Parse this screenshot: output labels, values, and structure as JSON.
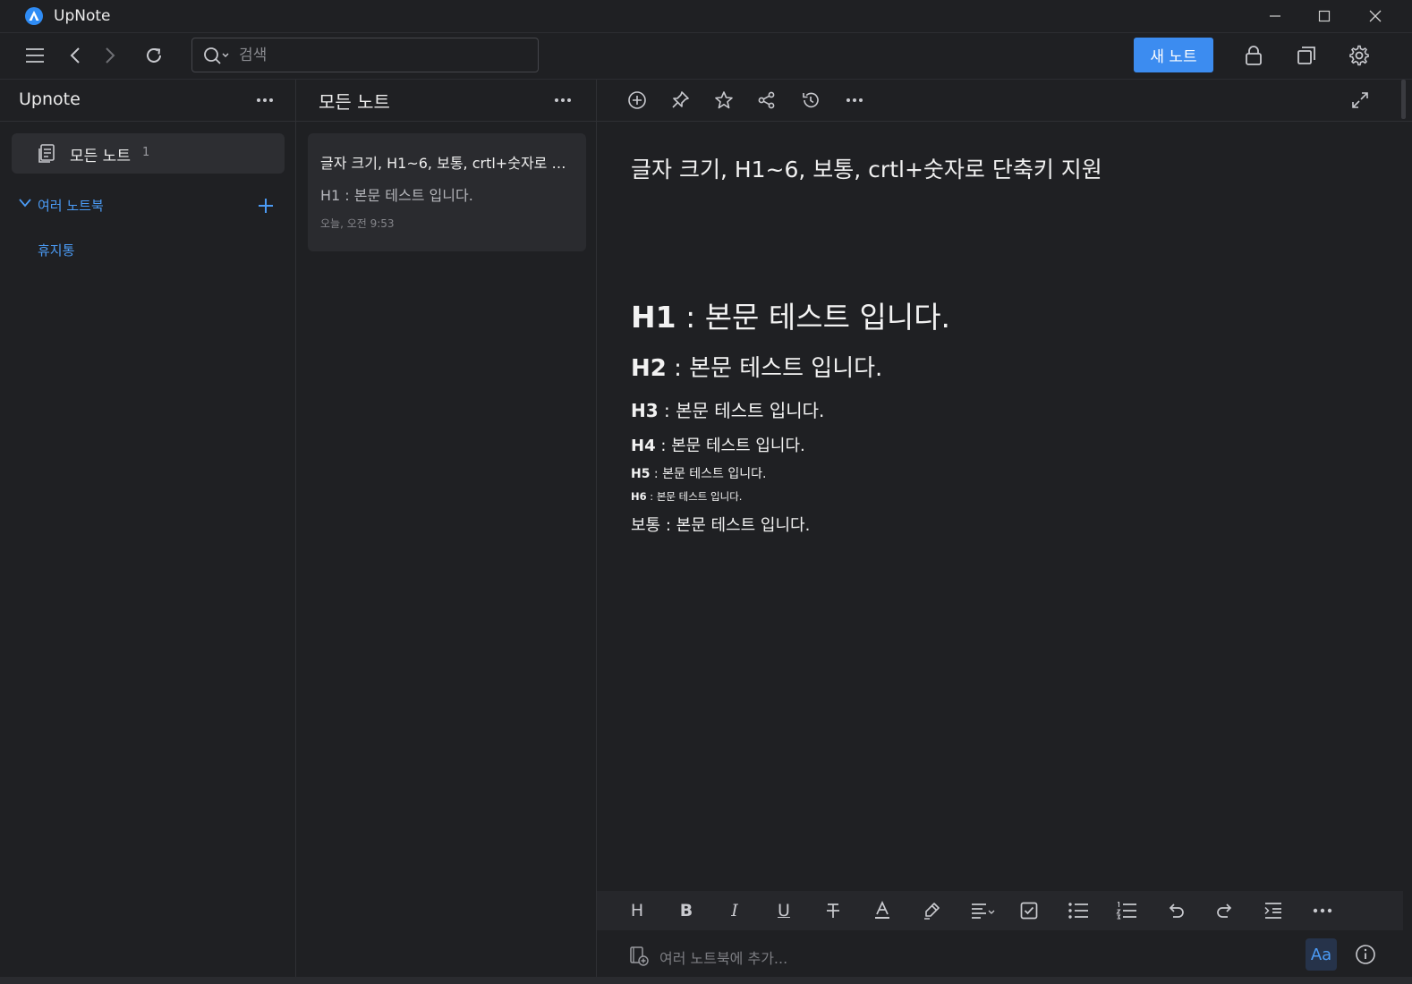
{
  "window": {
    "title": "UpNote",
    "logo_icon": "upnote-logo-icon",
    "controls": [
      "minimize-icon",
      "maximize-icon",
      "close-icon"
    ]
  },
  "toolbar": {
    "search_placeholder": "검색",
    "new_note_label": "새 노트",
    "accent": "#3c8cf0"
  },
  "sidebar": {
    "title": "Upnote",
    "all_notes_label": "모든 노트",
    "all_notes_count": "1",
    "notebooks_label": "여러 노트북",
    "trash_label": "휴지통",
    "link_color": "#4b9bf5"
  },
  "notelist": {
    "title": "모든 노트",
    "notes": [
      {
        "title": "글자 크기, H1~6, 보통, crtl+숫자로 단축키 지원",
        "preview": "H1 : 본문 테스트 입니다.",
        "date": "오늘, 오전 9:53"
      }
    ]
  },
  "editor": {
    "title": "글자 크기, H1~6, 보통, crtl+숫자로 단축키 지원",
    "lines": [
      {
        "tag": "H1",
        "text": ": 본문 테스트 입니다."
      },
      {
        "tag": "H2",
        "text": ": 본문 테스트 입니다."
      },
      {
        "tag": "H3",
        "text": ": 본문 테스트 입니다."
      },
      {
        "tag": "H4",
        "text": ": 본문 테스트 입니다."
      },
      {
        "tag": "H5",
        "text": ": 본문 테스트 입니다."
      },
      {
        "tag": "H6",
        "text": ": 본문 테스트 입니다."
      },
      {
        "tag": "보통",
        "text": ": 본문 테스트 입니다."
      }
    ],
    "format_heading": "H",
    "format_bold": "B",
    "format_italic": "I",
    "format_underline": "U",
    "add_notebook_placeholder": "여러 노트북에 추가...",
    "font_button": "Aa"
  }
}
